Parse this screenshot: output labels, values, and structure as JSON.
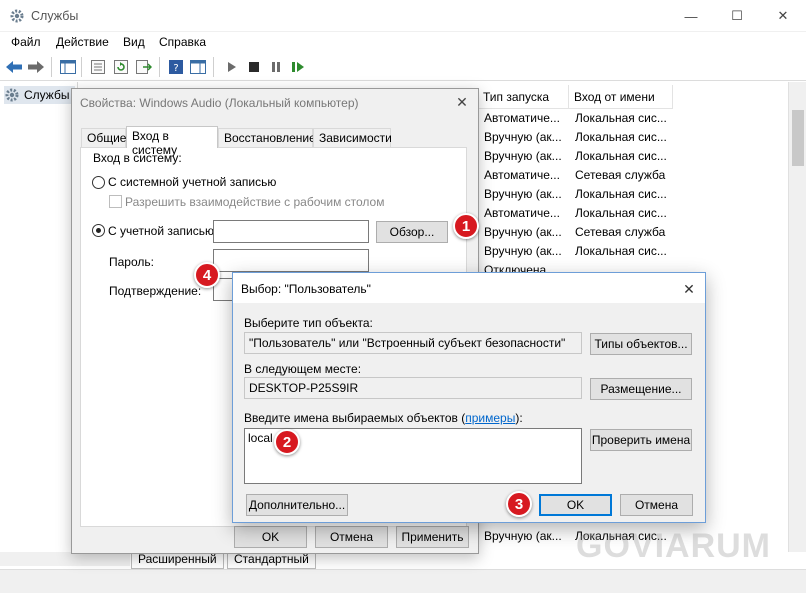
{
  "window": {
    "title": "Службы",
    "controls": {
      "minimize": "—",
      "maximize": "☐",
      "close": "✕"
    }
  },
  "menu": [
    "Файл",
    "Действие",
    "Вид",
    "Справка"
  ],
  "tree": {
    "label": "Службы"
  },
  "services": {
    "columns": {
      "startup": "Тип запуска",
      "logon": "Вход от имени"
    },
    "rows": [
      {
        "startup": "Автоматиче...",
        "logon": "Локальная сис..."
      },
      {
        "startup": "Вручную (ак...",
        "logon": "Локальная сис..."
      },
      {
        "startup": "Вручную (ак...",
        "logon": "Локальная сис..."
      },
      {
        "startup": "Автоматиче...",
        "logon": "Сетевая служба"
      },
      {
        "startup": "Вручную (ак...",
        "logon": "Локальная сис..."
      },
      {
        "startup": "Автоматиче...",
        "logon": "Локальная сис..."
      },
      {
        "startup": "Вручную (ак...",
        "logon": "Сетевая служба"
      },
      {
        "startup": "Вручную (ак...",
        "logon": "Локальная сис..."
      },
      {
        "startup": "Отключена",
        "logon": ""
      }
    ],
    "last_row": {
      "startup": "Вручную (ак...",
      "logon": "Локальная сис..."
    },
    "bottom_tabs": [
      "Расширенный",
      "Стандартный"
    ]
  },
  "properties_dialog": {
    "title": "Свойства: Windows Audio (Локальный компьютер)",
    "tabs": [
      "Общие",
      "Вход в систему",
      "Восстановление",
      "Зависимости"
    ],
    "logon_group": "Вход в систему:",
    "system_account": "С системной учетной записью",
    "allow_desktop": "Разрешить взаимодействие с рабочим столом",
    "this_account": "С учетной записью:",
    "account_value": "",
    "browse": "Обзор...",
    "password_label": "Пароль:",
    "confirm_label": "Подтверждение:",
    "ok": "OK",
    "cancel": "Отмена",
    "apply": "Применить"
  },
  "select_user_dialog": {
    "title": "Выбор: \"Пользователь\"",
    "object_type_label": "Выберите тип объекта:",
    "object_type_value": "\"Пользователь\" или \"Встроенный субъект безопасности\"",
    "object_types_button": "Типы объектов...",
    "location_label": "В следующем месте:",
    "location_value": "DESKTOP-P25S9IR",
    "locations_button": "Размещение...",
    "names_label_prefix": "Введите имена выбираемых объектов (",
    "names_label_link": "примеры",
    "names_label_suffix": "):",
    "names_value": "local",
    "check_names_button": "Проверить имена",
    "advanced_button": "Дополнительно...",
    "ok": "OK",
    "cancel": "Отмена"
  },
  "markers": [
    "1",
    "2",
    "3",
    "4"
  ],
  "watermark": "GOVIARUM",
  "colors": {
    "marker": "#d71920",
    "link": "#0066cc",
    "focus": "#0078d7"
  }
}
